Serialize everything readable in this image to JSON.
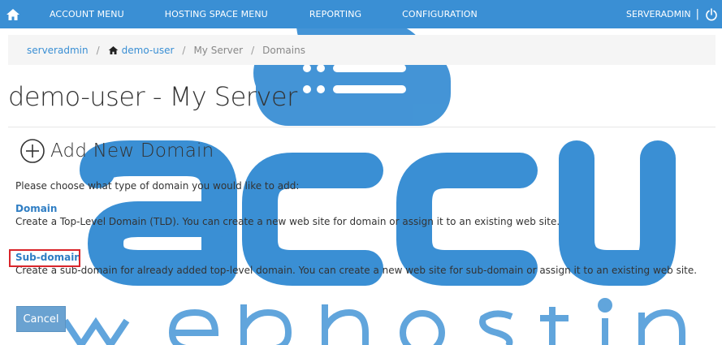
{
  "nav": {
    "home_icon": "home-icon",
    "items": [
      "ACCOUNT MENU",
      "HOSTING SPACE MENU",
      "REPORTING",
      "CONFIGURATION"
    ],
    "user": "SERVERADMIN",
    "separator": "|",
    "power_icon": "power-icon"
  },
  "breadcrumb": {
    "items": [
      "serveradmin",
      "demo-user",
      "My Server",
      "Domains"
    ],
    "separator": "/",
    "home_icon": "home-icon"
  },
  "page": {
    "title": "demo-user - My Server"
  },
  "section": {
    "icon": "plus-circle-icon",
    "title": "Add New Domain",
    "intro": "Please choose what type of domain you would like to add:",
    "options": [
      {
        "title": "Domain",
        "description": "Create a Top-Level Domain (TLD). You can create a new web site for domain or assign it to an existing web site."
      },
      {
        "title": "Sub-domain",
        "description": "Create a sub-domain for already added top-level domain. You can create a new web site for sub-domain or assign it to an existing web site."
      }
    ]
  },
  "actions": {
    "cancel_label": "Cancel"
  },
  "colors": {
    "nav_bg": "#3a8fd4",
    "link": "#2f7ec4",
    "highlight": "#d9252b",
    "button": "#6aa2d1",
    "watermark": "#3a8fd4"
  }
}
